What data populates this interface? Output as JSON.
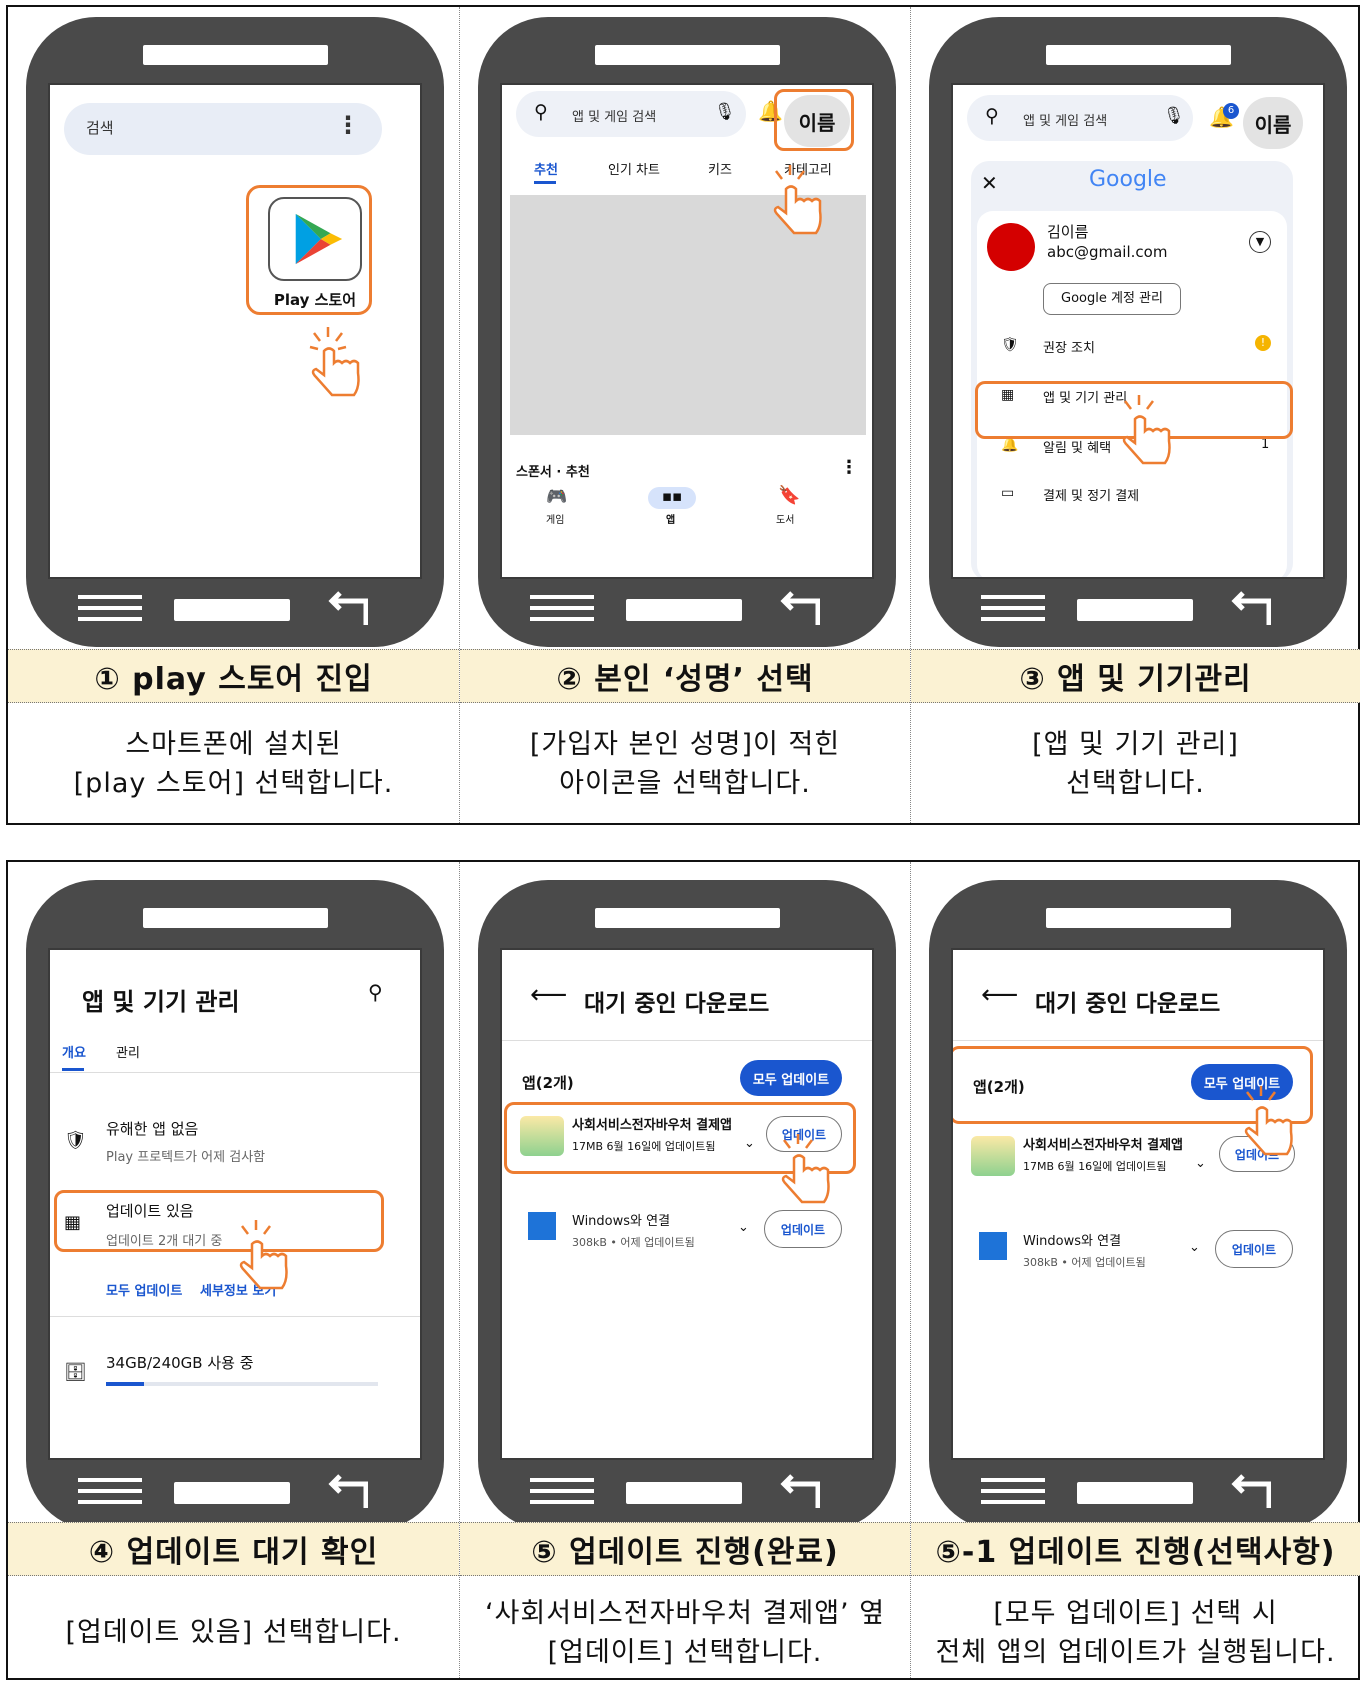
{
  "steps": [
    {
      "caption": "① play 스토어 진입",
      "desc": [
        "스마트폰에 설치된",
        "[play 스토어] 선택합니다."
      ]
    },
    {
      "caption": "② 본인 ‘성명’ 선택",
      "desc": [
        "[가입자 본인 성명]이 적힌",
        "아이콘을 선택합니다."
      ]
    },
    {
      "caption": "③ 앱 및 기기관리",
      "desc": [
        "[앱 및 기기 관리]",
        "선택합니다."
      ]
    },
    {
      "caption": "④ 업데이트 대기 확인",
      "desc": [
        "[업데이트 있음] 선택합니다."
      ]
    },
    {
      "caption": "⑤ 업데이트 진행(완료)",
      "desc": [
        "‘사회서비스전자바우처 결제앱’ 옆",
        "[업데이트] 선택합니다."
      ]
    },
    {
      "caption": "⑤-1 업데이트 진행(선택사항)",
      "desc": [
        "[모두 업데이트] 선택 시",
        "전체 앱의 업데이트가 실행됩니다."
      ]
    }
  ],
  "screen1": {
    "search_label": "검색",
    "app_label": "Play 스토어"
  },
  "screen2": {
    "search_placeholder": "앱 및 게임 검색",
    "profile": "이름",
    "tabs": [
      "추천",
      "인기 차트",
      "키즈",
      "카테고리"
    ],
    "section": "스폰서 · 추천",
    "bottom_nav": [
      "게임",
      "앱",
      "도서"
    ]
  },
  "screen3": {
    "search_placeholder": "앱 및 게임 검색",
    "profile": "이름",
    "badge": "6",
    "google": "Google",
    "user_name": "김이름",
    "user_email": "abc@gmail.com",
    "manage_account": "Google 계정 관리",
    "menu": [
      "권장 조치",
      "앱 및 기기 관리",
      "알림 및 혜택",
      "결제 및 정기 결제"
    ],
    "notif_count": "1"
  },
  "screen4": {
    "title": "앱 및 기기 관리",
    "tabs": [
      "개요",
      "관리"
    ],
    "item1_title": "유해한 앱 없음",
    "item1_sub": "Play 프로텍트가 어제 검사함",
    "item2_title": "업데이트 있음",
    "item2_sub": "업데이트 2개 대기 중",
    "link_update_all": "모두 업데이트",
    "link_details": "세부정보 보기",
    "storage": "34GB/240GB 사용 중",
    "storage_fraction": 0.14
  },
  "screen5": {
    "title": "대기 중인 다운로드",
    "apps_count": "앱(2개)",
    "update_all": "모두 업데이트",
    "app1_name": "사회서비스전자바우처 결제앱",
    "app1_meta": "17MB 6월 16일에 업데이트됨",
    "app2_name": "Windows와 연결",
    "app2_meta": "308kB • 어제 업데이트됨",
    "update_btn": "업데이트"
  },
  "colors": {
    "highlight": "#ed7d31",
    "caption_bg": "#fbf2d3",
    "phone": "#4a4a4a",
    "accent": "#1a56cf"
  }
}
